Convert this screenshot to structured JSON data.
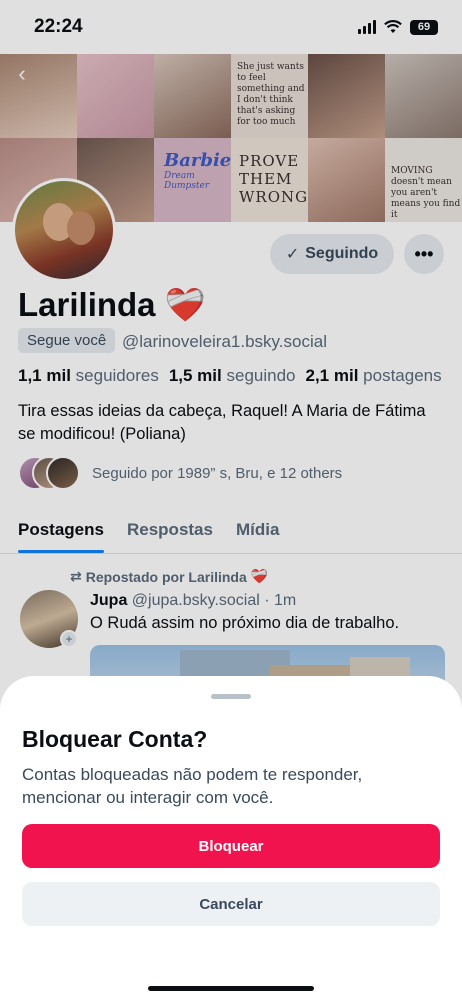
{
  "status_bar": {
    "time": "22:24",
    "battery": "69"
  },
  "banner": {
    "note_text": "She just wants to feel something and I don't think that's asking for too much",
    "barbie_title": "Barbie",
    "barbie_sub": "Dream Dumpster",
    "prove_text": "PROVE THEM WRONG",
    "moving_text": "MOVING doesn't mean you aren't means you find it"
  },
  "profile": {
    "display_name": "Larilinda",
    "name_emoji": "❤️‍🩹",
    "follows_you": "Segue você",
    "handle": "@larinoveleira1.bsky.social",
    "following_button": "Seguindo",
    "more_button": "•••",
    "stats": {
      "followers_count": "1,1 mil",
      "followers_label": "seguidores",
      "following_count": "1,5 mil",
      "following_label": "seguindo",
      "posts_count": "2,1 mil",
      "posts_label": "postagens"
    },
    "bio": "Tira essas ideias da cabeça, Raquel! A Maria de Fátima se modificou!  (Poliana)",
    "followed_by": "Seguido por 1989” s, Bru, e 12 others"
  },
  "tabs": [
    {
      "label": "Postagens",
      "active": true
    },
    {
      "label": "Respostas",
      "active": false
    },
    {
      "label": "Mídia",
      "active": false
    }
  ],
  "post": {
    "repost_label": "Repostado por Larilinda",
    "repost_emoji": "❤️‍🩹",
    "author": "Jupa",
    "handle": "@jupa.bsky.social",
    "time": "· 1m",
    "text": "O Rudá assim no próximo dia de trabalho."
  },
  "sheet": {
    "title": "Bloquear Conta?",
    "description": "Contas bloqueadas não podem te responder, mencionar ou interagir com você.",
    "confirm_label": "Bloquear",
    "cancel_label": "Cancelar"
  },
  "colors": {
    "accent": "#1083fe",
    "danger": "#f0134d",
    "muted_text": "#5a6a7c"
  }
}
